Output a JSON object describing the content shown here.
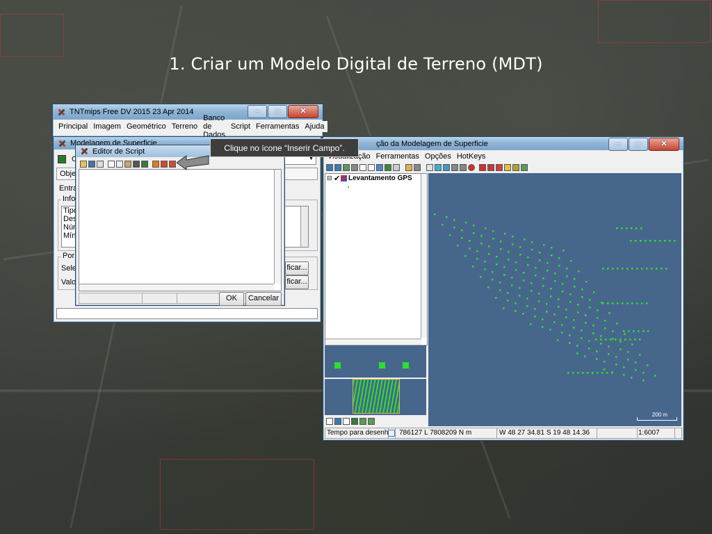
{
  "slide": {
    "title": "1. Criar um Modelo Digital de Terreno (MDT)"
  },
  "callout": {
    "text": "Clique no ícone “Inserir Campo”."
  },
  "main_window": {
    "title": "TNTmips Free DV 2015   23 Apr 2014",
    "menu": [
      "Principal",
      "Imagem",
      "Geométrico",
      "Terreno",
      "Banco de Dados",
      "Script",
      "Ferramentas",
      "Ajuda"
    ]
  },
  "surface_window": {
    "title_partial": "Modelagem de Superficie",
    "row_labels": [
      "O",
      "Objet",
      "Entrac",
      "Info",
      "Tipo",
      "Des",
      "Núm",
      "Míni",
      "Por",
      "Sele",
      "Valo"
    ],
    "button_label": "ficar..."
  },
  "script_editor": {
    "title": "Editor de Script",
    "ok": "OK",
    "cancel": "Cancelar"
  },
  "viewer_window": {
    "title_partial": "ção da Modelagem de Superficie",
    "menu": [
      "Visualização",
      "Ferramentas",
      "Opções",
      "HotKeys"
    ],
    "layer_name": "Levantamento GPS",
    "scale_bar_label": "200 m",
    "status": {
      "label": "Tempo para desenhar",
      "coords": "786127 L  7808209 N m",
      "latlon": "W 48 27 34.81  S 19 48 14.36",
      "scale": "1:6007"
    }
  },
  "colors": {
    "map_bg": "#47668c",
    "points": "#2de02d",
    "callout_bg": "#3d3d3d"
  }
}
